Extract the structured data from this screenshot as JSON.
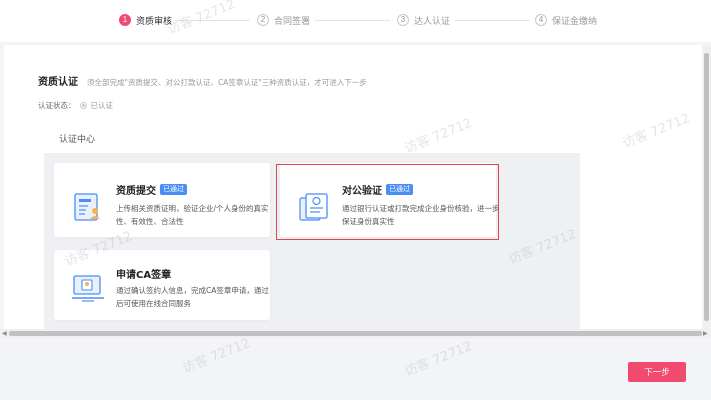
{
  "stepper": {
    "steps": [
      {
        "num": "1",
        "label": "资质审核"
      },
      {
        "num": "2",
        "label": "合同签署"
      },
      {
        "num": "3",
        "label": "达人认证"
      },
      {
        "num": "4",
        "label": "保证金缴纳"
      }
    ]
  },
  "section": {
    "title": "资质认证",
    "desc": "须全部完成\"资质提交、对公打款认证、CA签章认证\"三种资质认证，才可进入下一步"
  },
  "status": {
    "label": "认证状态：",
    "value": "已认证"
  },
  "center": {
    "title": "认证中心",
    "cards": [
      {
        "title": "资质提交",
        "badge": "已通过",
        "desc": "上传相关资质证明，验证企业/个人身份的真实性、有效性、合法性"
      },
      {
        "title": "对公验证",
        "badge": "已通过",
        "desc": "通过银行认证或打款完成企业身份核验，进一步保证身份真实性"
      },
      {
        "title": "申请CA签章",
        "badge": "",
        "desc": "通过确认签约人信息，完成CA签章申请，通过后可使用在线合同服务"
      }
    ]
  },
  "footer": {
    "next_label": "下一步"
  },
  "watermark": "访客 72712",
  "colors": {
    "accent": "#f04a6f",
    "badge": "#4a8ef5",
    "highlight": "#e2454b"
  }
}
